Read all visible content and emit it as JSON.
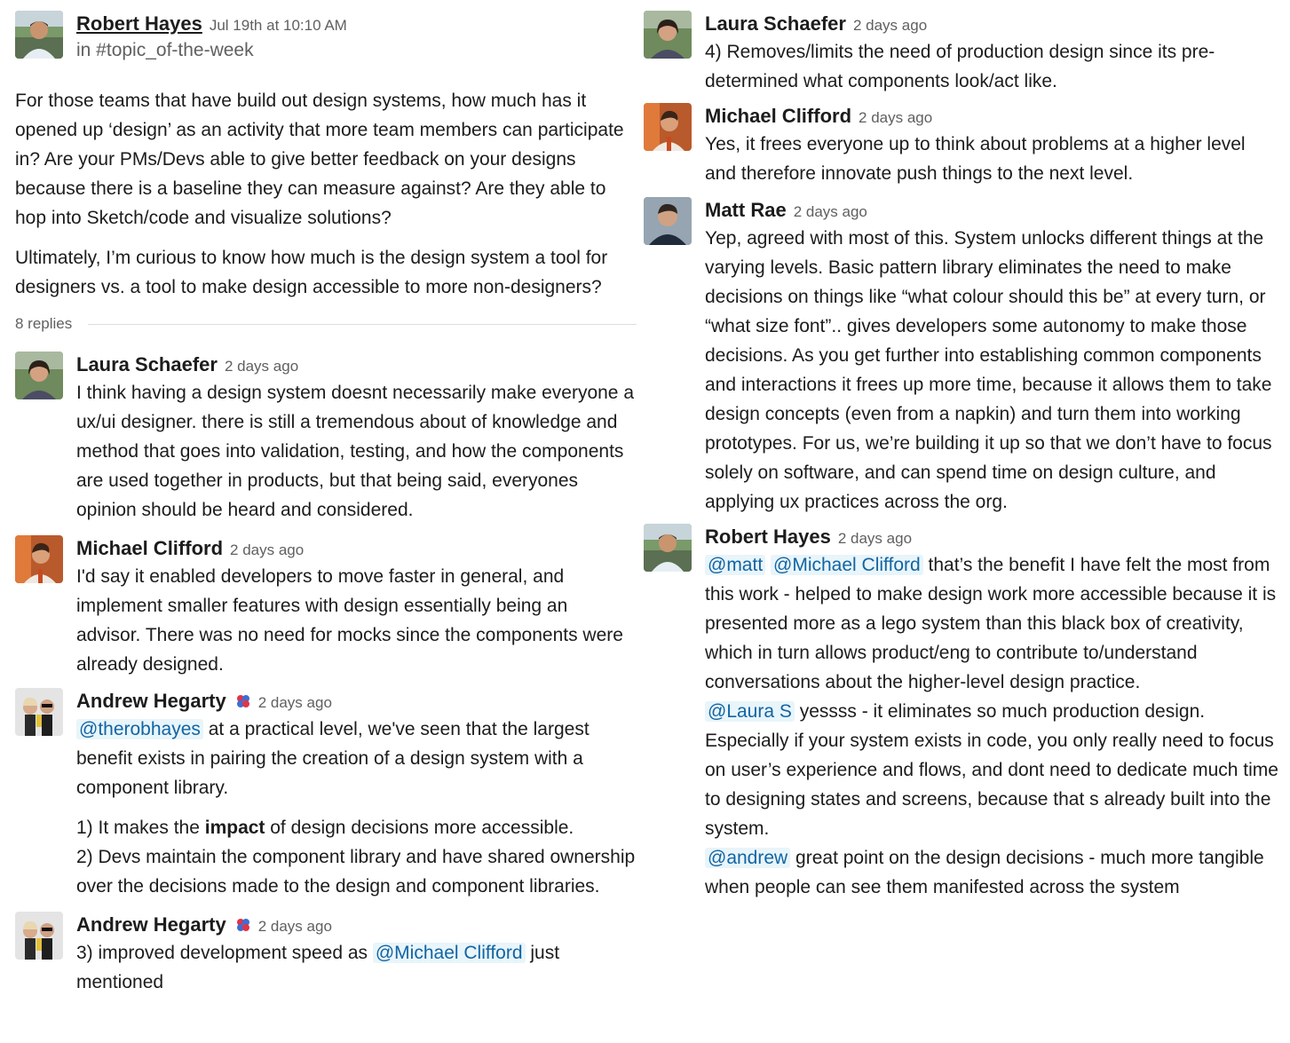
{
  "root": {
    "author": "Robert Hayes",
    "timestamp": "Jul 19th at 10:10 AM",
    "channel": "in #topic_of-the-week",
    "paragraph1": "For those teams that have build out design systems, how much has it opened up ‘design’ as an activity that more team members can participate in? Are your PMs/Devs able to give better feedback on your designs because there is a baseline they can measure against? Are they able to hop into Sketch/code and visualize solutions?",
    "paragraph2": "Ultimately, I’m curious to know how much is the design system a tool for designers vs. a tool to make design accessible to more non-designers?",
    "replies_count": "8 replies"
  },
  "replies_left": [
    {
      "author": "Laura Schaefer",
      "time": "2 days ago",
      "text": "I think having a design system doesnt necessarily make everyone a ux/ui designer. there is still a tremendous about of knowledge and method that goes into validation, testing, and how the components are used together in products, but that being said, everyones opinion should be heard and considered."
    },
    {
      "author": "Michael Clifford",
      "time": "2 days ago",
      "text": "I'd say it enabled developers to move faster in general, and implement smaller features with design essentially being an advisor. There was no need for mocks since the components were already designed."
    },
    {
      "author": "Andrew Hegarty",
      "time": "2 days ago",
      "mention": "@therobhayes",
      "text_after_mention": " at a practical level, we've seen that the largest benefit exists in pairing the creation of a design system with a component library.",
      "list1_prefix": "1) It makes the ",
      "list1_bold": "impact",
      "list1_suffix": " of design decisions more accessible.",
      "list2": "2) Devs maintain the component library and have shared ownership over the decisions made to the design and component libraries."
    },
    {
      "author": "Andrew Hegarty",
      "time": "2 days ago",
      "text_before": "3) improved development speed as ",
      "mention": "@Michael Clifford",
      "text_after": " just mentioned"
    }
  ],
  "replies_right": [
    {
      "author": "Laura Schaefer",
      "time": "2 days ago",
      "text": "4) Removes/limits the need of production design since its pre-determined what components look/act like."
    },
    {
      "author": "Michael Clifford",
      "time": "2 days ago",
      "text": "Yes, it frees everyone up to think about problems at a higher level and therefore innovate push things to the next level."
    },
    {
      "author": "Matt Rae",
      "time": "2 days ago",
      "text": "Yep, agreed with most of this. System unlocks different things at the varying levels. Basic pattern library eliminates the need to make decisions on things like “what colour should this be” at every turn, or “what size font”.. gives developers some autonomy to make those decisions. As you get further into establishing common components and interactions it frees up more time, because it allows them to take design concepts (even from a napkin) and turn them into working prototypes. For us, we’re building it up so that we don’t have to focus solely on software, and can spend time on design culture, and applying ux practices across the org."
    },
    {
      "author": "Robert Hayes",
      "time": "2 days ago",
      "mention1": "@matt",
      "mention2": "@Michael Clifford",
      "text1": " that’s the benefit I have felt the most from this work - helped to make design work more accessible because it is presented more as a lego system than this black box of creativity, which in turn allows product/eng to contribute to/understand conversations about the higher-level design practice.",
      "mention3": "@Laura S",
      "text2": " yessss - it eliminates so much production design. Especially if your system exists in code, you only really need to focus on user’s experience and flows, and dont need to dedicate much time to designing states and screens, because that s already built into the system.",
      "mention4": "@andrew",
      "text3": " great point on the design decisions - much more tangible when people can see them manifested across the system"
    }
  ]
}
